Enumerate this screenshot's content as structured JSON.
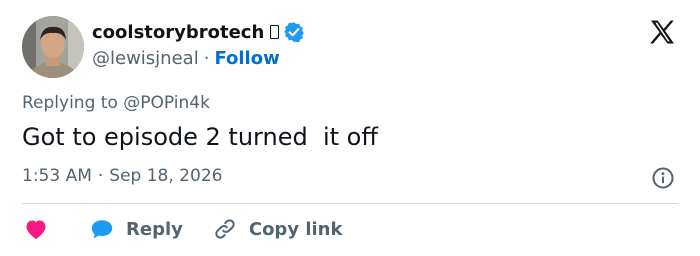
{
  "author": {
    "display_name": "coolstorybrotech",
    "handle": "@lewisjneal",
    "separator": "·",
    "follow_label": "Follow"
  },
  "reply_to": {
    "prefix": "Replying to",
    "mention": "@POPin4k"
  },
  "tweet": {
    "text": "Got to episode 2 turned  it off",
    "time": "1:53 AM",
    "separator": "·",
    "date": "Sep 18, 2026"
  },
  "actions": {
    "reply_label": "Reply",
    "copy_label": "Copy link"
  },
  "colors": {
    "link_blue": "#006fd6",
    "verified_blue": "#1d9bf0",
    "heart_pink": "#f91880",
    "muted_gray": "#536471",
    "text_dark": "#0f1419"
  },
  "icons": [
    "x-logo-icon",
    "verified-badge-icon",
    "info-icon",
    "heart-icon",
    "reply-bubble-icon",
    "link-icon"
  ]
}
